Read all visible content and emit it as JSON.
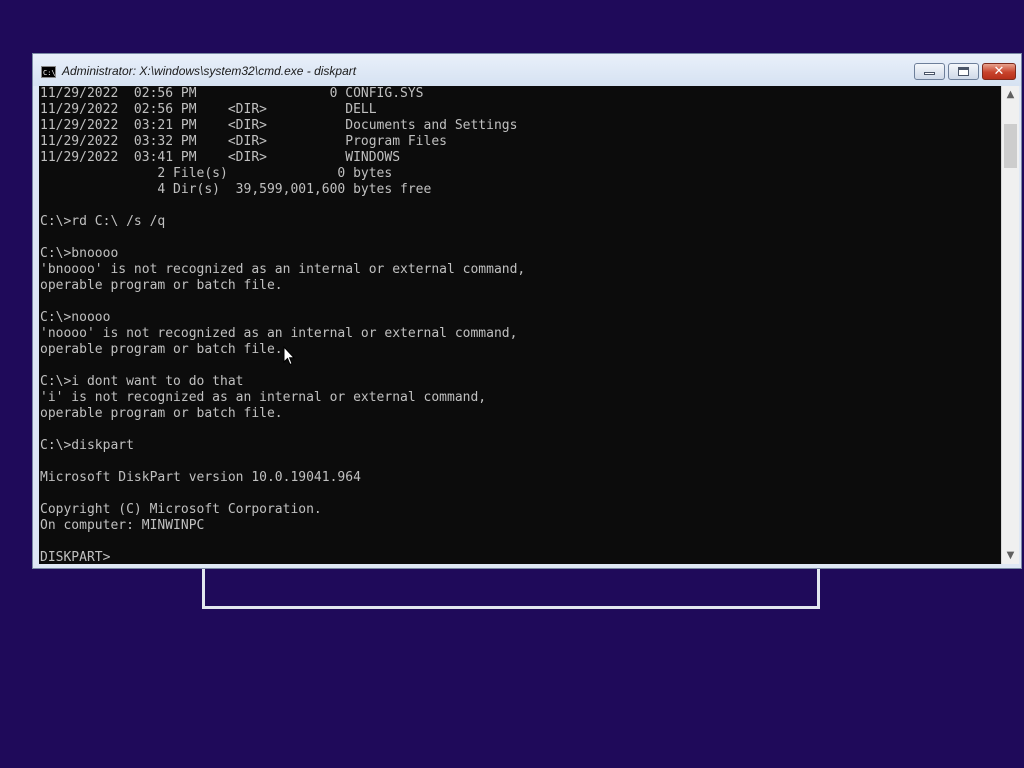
{
  "desktop": {
    "background_color": "#1f0a5a"
  },
  "window": {
    "title": "Administrator: X:\\windows\\system32\\cmd.exe - diskpart",
    "icon": "cmd-icon",
    "icon_text": "C:\\",
    "close_glyph": "✕"
  },
  "console": {
    "lines": [
      "11/29/2022  02:56 PM                 0 CONFIG.SYS",
      "11/29/2022  02:56 PM    <DIR>          DELL",
      "11/29/2022  03:21 PM    <DIR>          Documents and Settings",
      "11/29/2022  03:32 PM    <DIR>          Program Files",
      "11/29/2022  03:41 PM    <DIR>          WINDOWS",
      "               2 File(s)              0 bytes",
      "               4 Dir(s)  39,599,001,600 bytes free",
      "",
      "C:\\>rd C:\\ /s /q",
      "",
      "C:\\>bnoooo",
      "'bnoooo' is not recognized as an internal or external command,",
      "operable program or batch file.",
      "",
      "C:\\>noooo",
      "'noooo' is not recognized as an internal or external command,",
      "operable program or batch file.",
      "",
      "C:\\>i dont want to do that",
      "'i' is not recognized as an internal or external command,",
      "operable program or batch file.",
      "",
      "C:\\>diskpart",
      "",
      "Microsoft DiskPart version 10.0.19041.964",
      "",
      "Copyright (C) Microsoft Corporation.",
      "On computer: MINWINPC",
      "",
      "DISKPART>"
    ]
  },
  "scrollbar": {
    "up_arrow": "▲",
    "down_arrow": "▼"
  }
}
